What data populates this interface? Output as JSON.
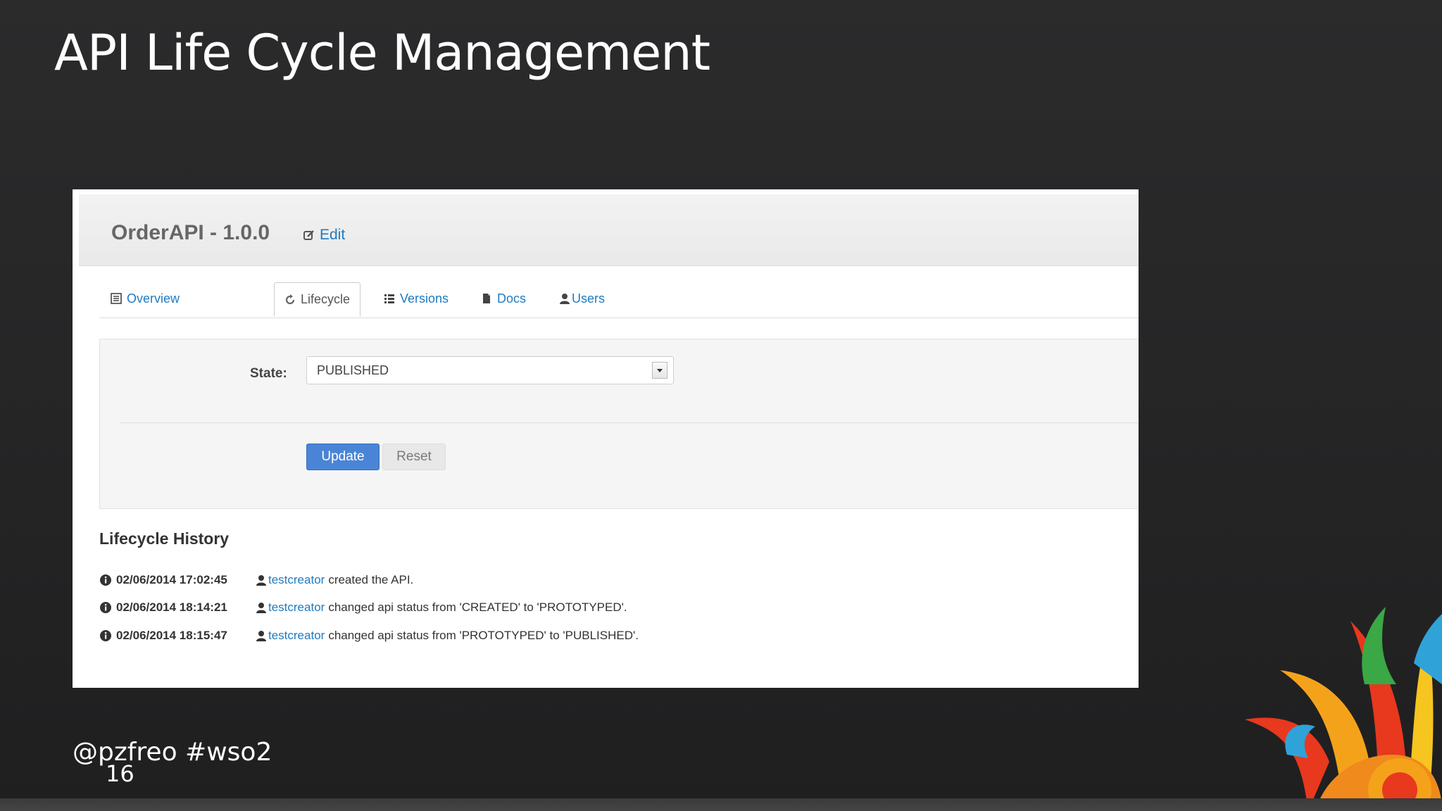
{
  "slide": {
    "title": "API Life Cycle Management",
    "handle": "@pzfreo #wso2",
    "page_number": "16"
  },
  "api": {
    "title": "OrderAPI - 1.0.0",
    "edit_label": "Edit"
  },
  "tabs": [
    {
      "label": "Overview",
      "icon": "list-alt-icon",
      "active": false
    },
    {
      "label": "Lifecycle",
      "icon": "refresh-icon",
      "active": true
    },
    {
      "label": "Versions",
      "icon": "list-icon",
      "active": false
    },
    {
      "label": "Docs",
      "icon": "file-icon",
      "active": false
    },
    {
      "label": "Users",
      "icon": "user-icon",
      "active": false
    }
  ],
  "lifecycle_form": {
    "state_label": "State:",
    "state_value": "PUBLISHED",
    "update_label": "Update",
    "reset_label": "Reset"
  },
  "history": {
    "title": "Lifecycle History",
    "entries": [
      {
        "date": "02/06/2014 17:02:45",
        "user": "testcreator",
        "message": "created the API."
      },
      {
        "date": "02/06/2014 18:14:21",
        "user": "testcreator",
        "message": "changed api status from 'CREATED' to 'PROTOTYPED'."
      },
      {
        "date": "02/06/2014 18:15:47",
        "user": "testcreator",
        "message": "changed api status from 'PROTOTYPED' to 'PUBLISHED'."
      }
    ]
  },
  "colors": {
    "link": "#1f7bc1",
    "primary_button": "#4a84d6",
    "slide_background": "#262627"
  }
}
